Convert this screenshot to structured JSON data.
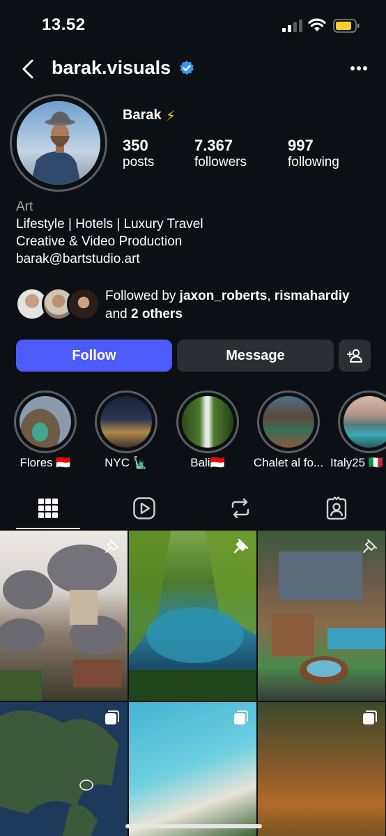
{
  "status_bar": {
    "time": "13.52"
  },
  "header": {
    "username": "barak.visuals"
  },
  "profile": {
    "display_name": "Barak",
    "stats": [
      {
        "value": "350",
        "label": "posts"
      },
      {
        "value": "7.367",
        "label": "followers"
      },
      {
        "value": "997",
        "label": "following"
      }
    ],
    "category": "Art",
    "bio_lines": [
      "Lifestyle | Hotels | Luxury Travel",
      "Creative & Video Production",
      "barak@bartstudio.art"
    ],
    "followed_by": {
      "prefix": "Followed by ",
      "users": [
        "jaxon_roberts",
        "rismahardiy"
      ],
      "separator": ", ",
      "and_text": "and ",
      "others": "2 others"
    }
  },
  "actions": {
    "follow_label": "Follow",
    "message_label": "Message"
  },
  "highlights": [
    {
      "label": "Flores 🇮🇩"
    },
    {
      "label": "NYC 🗽"
    },
    {
      "label": "Bali🇮🇩"
    },
    {
      "label": "Chalet al fo..."
    },
    {
      "label": "Italy25 🇮🇹"
    }
  ],
  "tabs": [
    "grid-icon",
    "reels-icon",
    "reposts-icon",
    "tagged-icon"
  ],
  "colors": {
    "accent": "#4d5bf9",
    "verified": "#3897f0",
    "background": "#0c1014"
  }
}
